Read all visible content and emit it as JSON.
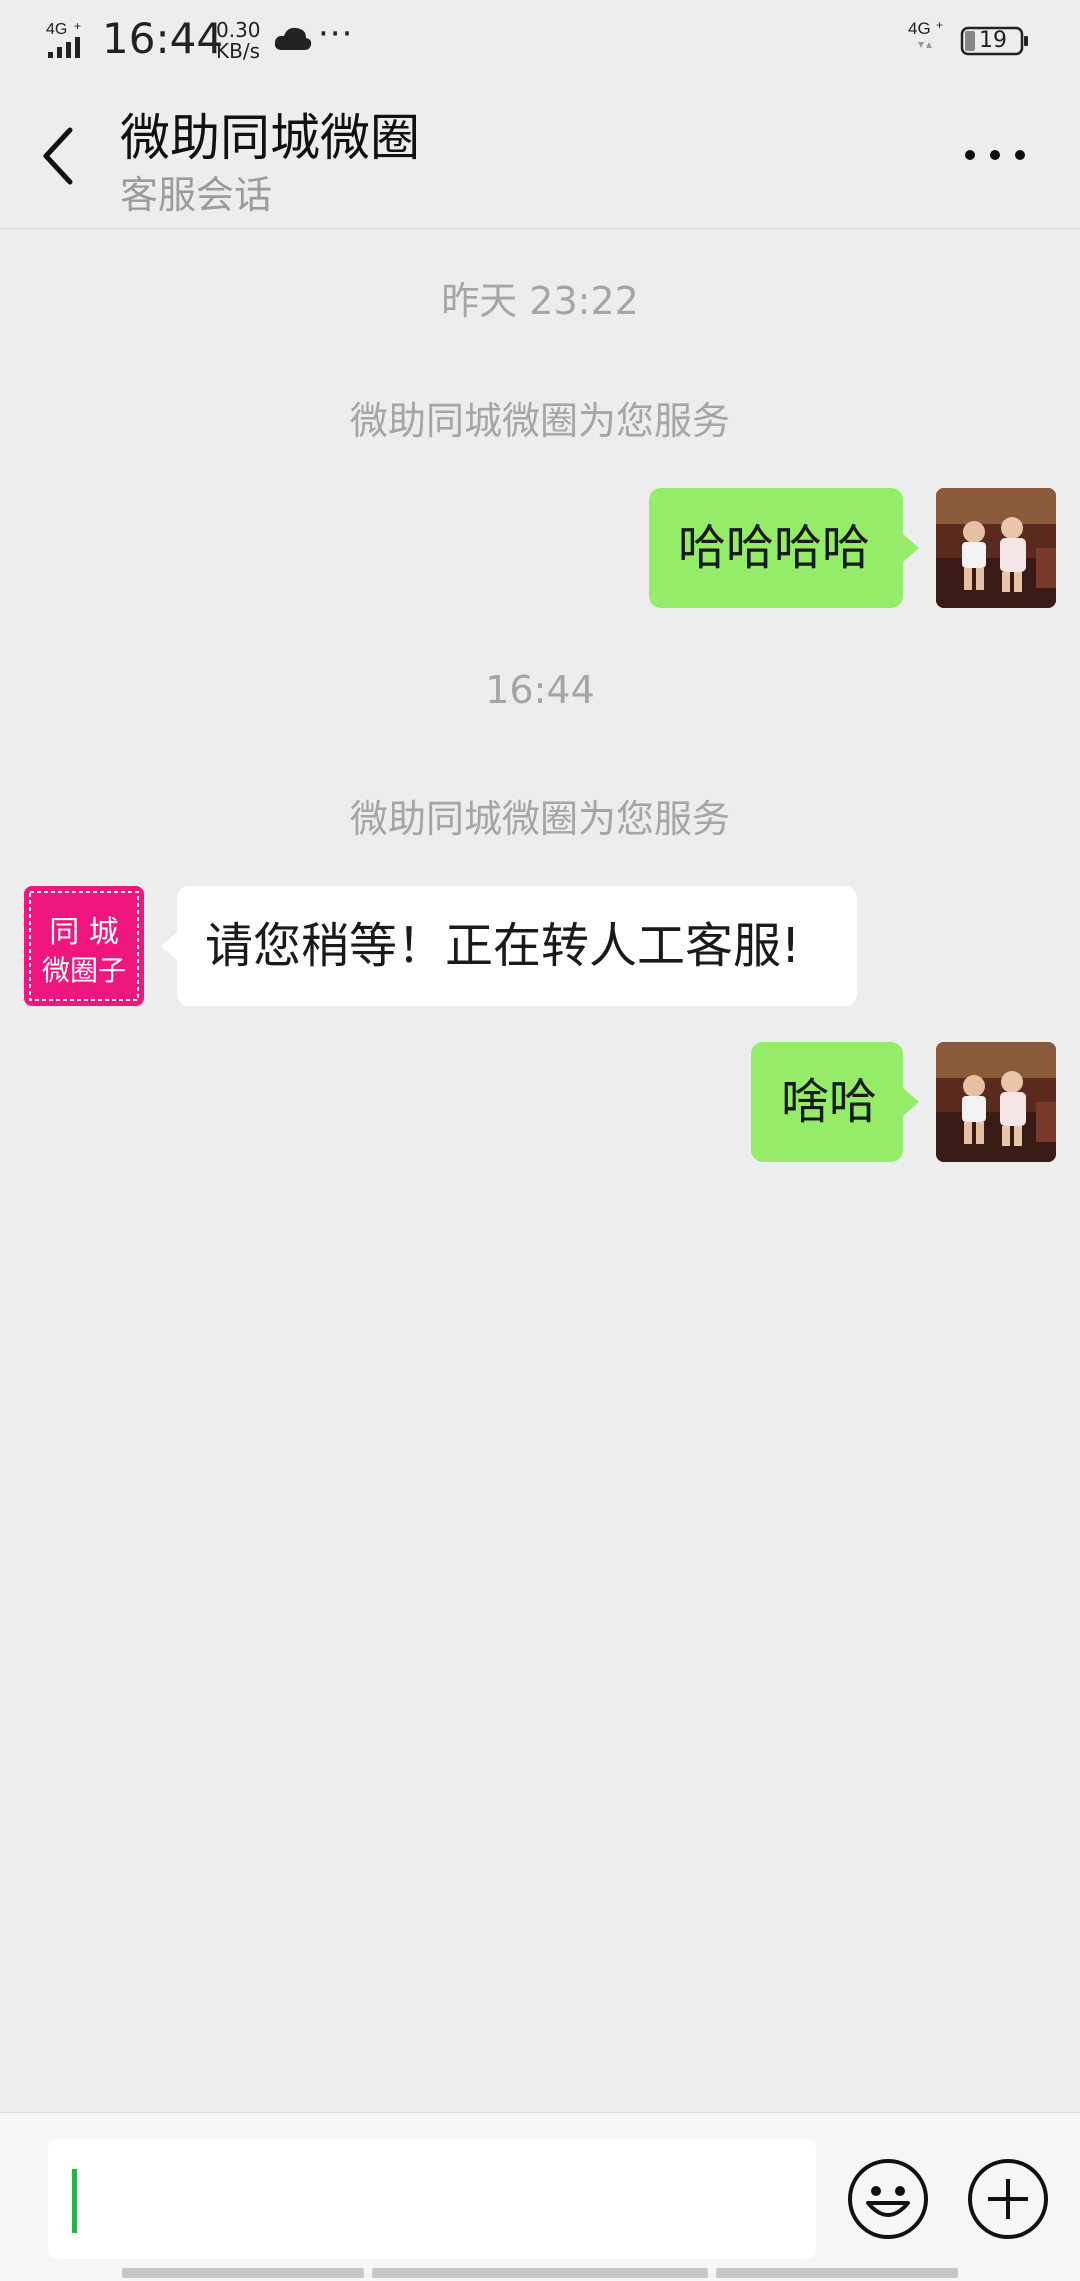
{
  "status_bar": {
    "network_left": "4G",
    "time": "16:44",
    "speed_value": "0.30",
    "speed_unit": "KB/s",
    "more": "···",
    "network_right": "4G",
    "battery": "19"
  },
  "header": {
    "title": "微助同城微圈",
    "subtitle": "客服会话"
  },
  "messages": {
    "time_1": "昨天 23:22",
    "system_1": "微助同城微圈为您服务",
    "msg_1": "哈哈哈哈",
    "time_2": "16:44",
    "system_2": "微助同城微圈为您服务",
    "msg_2": "请您稍等！正在转人工客服!",
    "msg_3": "啥哈"
  },
  "bot_avatar": {
    "line1": "同 城",
    "line2": "微圈子"
  },
  "colors": {
    "background": "#ededed",
    "my_bubble": "#95ec69",
    "their_bubble": "#ffffff",
    "bot_avatar": "#f0167f",
    "caret": "#2bb24c"
  },
  "icons": {
    "back": "chevron-left-icon",
    "more": "more-dots-icon",
    "emoji": "smiley-icon",
    "plus": "plus-circle-icon",
    "cloud": "cloud-icon",
    "signal": "signal-icon",
    "battery": "battery-icon"
  }
}
